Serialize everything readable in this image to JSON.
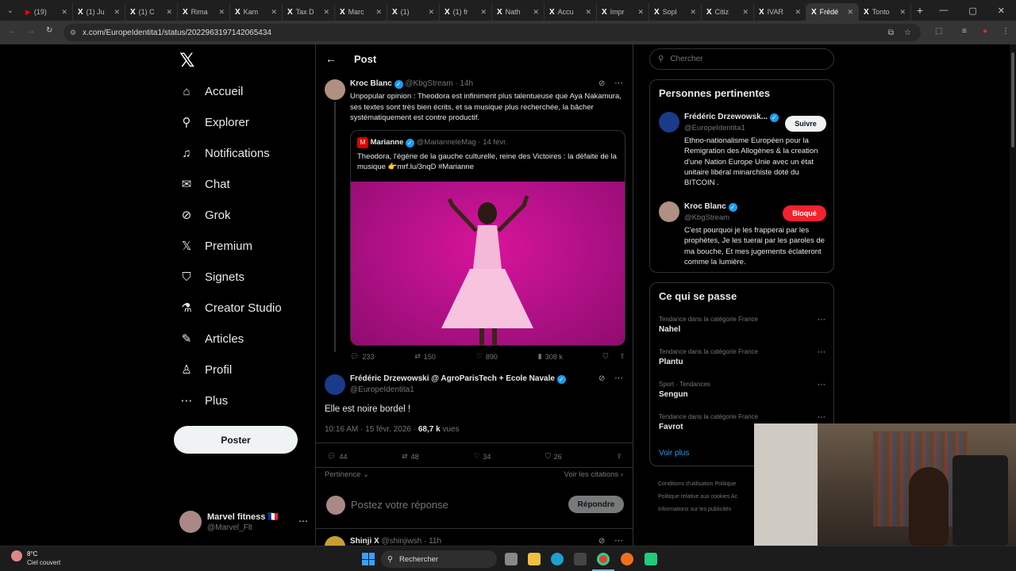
{
  "browser": {
    "tabs": [
      {
        "label": "(19)",
        "icon": "youtube-icon"
      },
      {
        "label": "(1) Ju",
        "icon": "x-icon"
      },
      {
        "label": "(1) C",
        "icon": "x-icon"
      },
      {
        "label": "Rima",
        "icon": "x-icon"
      },
      {
        "label": "Kam",
        "icon": "x-icon"
      },
      {
        "label": "Tax D",
        "icon": "x-icon"
      },
      {
        "label": "Marc",
        "icon": "x-icon"
      },
      {
        "label": "(1)",
        "icon": "x-icon"
      },
      {
        "label": "(1) fr",
        "icon": "x-icon"
      },
      {
        "label": "Nath",
        "icon": "x-icon"
      },
      {
        "label": "Accu",
        "icon": "x-icon"
      },
      {
        "label": "Impr",
        "icon": "x-icon"
      },
      {
        "label": "Sopl",
        "icon": "x-icon"
      },
      {
        "label": "Citiz",
        "icon": "x-icon"
      },
      {
        "label": "IVAR",
        "icon": "x-icon"
      },
      {
        "label": "Frédé",
        "icon": "x-icon",
        "active": true
      },
      {
        "label": "Tonto",
        "icon": "x-icon"
      }
    ],
    "url": "x.com/EuropeIdentita1/status/2022963197142065434"
  },
  "sidebar": {
    "items": [
      {
        "label": "Accueil",
        "icon": "home-icon"
      },
      {
        "label": "Explorer",
        "icon": "search-icon"
      },
      {
        "label": "Notifications",
        "icon": "bell-icon"
      },
      {
        "label": "Chat",
        "icon": "mail-icon"
      },
      {
        "label": "Grok",
        "icon": "grok-icon"
      },
      {
        "label": "Premium",
        "icon": "x-icon"
      },
      {
        "label": "Signets",
        "icon": "bookmark-icon"
      },
      {
        "label": "Creator Studio",
        "icon": "flask-icon"
      },
      {
        "label": "Articles",
        "icon": "article-icon"
      },
      {
        "label": "Profil",
        "icon": "person-icon"
      },
      {
        "label": "Plus",
        "icon": "more-circle-icon"
      }
    ],
    "post_button": "Poster",
    "account": {
      "name": "Marvel fitness 🇫🇷",
      "handle": "@Marvel_Flt"
    }
  },
  "header": {
    "title": "Post"
  },
  "parent_post": {
    "author": "Kroc Blanc",
    "handle": "@KbgStream",
    "time": "· 14h",
    "text": "Unpopular opinion : Theodora est infiniment plus talentueuse que Aya Nakamura, ses textes sont très bien écrits, et sa musique plus recherchée, la bâcher systématiquement est contre productif.",
    "quote": {
      "author": "Marianne",
      "handle": "@MarianneleMag",
      "time": "· 14 févr.",
      "text": "Theodora, l'égérie de la gauche culturelle, reine des Victoires : la défaite de la musique 👉mrf.lu/3nqD #Marianne"
    },
    "stats": {
      "replies": "233",
      "reposts": "150",
      "likes": "890",
      "views": "308 k"
    }
  },
  "main_post": {
    "author": "Frédéric Drzewowski @ AgroParisTech + Ecole Navale",
    "handle": "@EuropeIdentita1",
    "text": "Elle est noire bordel !",
    "timestamp": "10:16 AM · 15 févr. 2026 ·",
    "views_count": "68,7 k",
    "views_label": "vues",
    "stats": {
      "replies": "44",
      "reposts": "48",
      "likes": "34",
      "bookmarks": "26"
    },
    "sort_label": "Pertinence",
    "quotes_link": "Voir les citations"
  },
  "reply_box": {
    "placeholder": "Postez votre réponse",
    "button": "Répondre"
  },
  "next_reply": {
    "author": "Shinji X",
    "handle": "@shinjiwsh",
    "time": "· 11h"
  },
  "search": {
    "placeholder": "Chercher"
  },
  "relevant_people": {
    "title": "Personnes pertinentes",
    "people": [
      {
        "name": "Frédéric Drzewowsk...",
        "handle": "@EuropeIdentita1",
        "button": "Suivre",
        "bio": "Ethno-nationalisme Européen pour la Remigration des Allogènes & la creation d'une Nation Europe Unie avec un état unitaire libéral minarchiste doté du BITCOIN ."
      },
      {
        "name": "Kroc Blanc",
        "handle": "@KbgStream",
        "button": "Bloqué",
        "bio": "C'est pourquoi je les frapperai par les prophètes, Je les tuerai par les paroles de ma bouche, Et mes jugements éclateront comme la lumière."
      }
    ]
  },
  "trends": {
    "title": "Ce qui se passe",
    "items": [
      {
        "context": "Tendance dans la catégorie France",
        "name": "Nahel"
      },
      {
        "context": "Tendance dans la catégorie France",
        "name": "Plantu"
      },
      {
        "context": "Sport · Tendances",
        "name": "Sengun"
      },
      {
        "context": "Tendance dans la catégorie France",
        "name": "Favrot"
      }
    ],
    "more": "Voir plus"
  },
  "footer_links": [
    "Conditions d'utilisation",
    "Politique",
    "Politique relative aux cookies",
    "Ac",
    "Informations sur les publicités"
  ],
  "taskbar": {
    "weather_temp": "8°C",
    "weather_desc": "Ciel couvert",
    "search": "Rechercher"
  },
  "colors": {
    "accent": "#1d9bf0",
    "danger": "#f4212e",
    "background": "#000000",
    "border": "#2f3336"
  }
}
